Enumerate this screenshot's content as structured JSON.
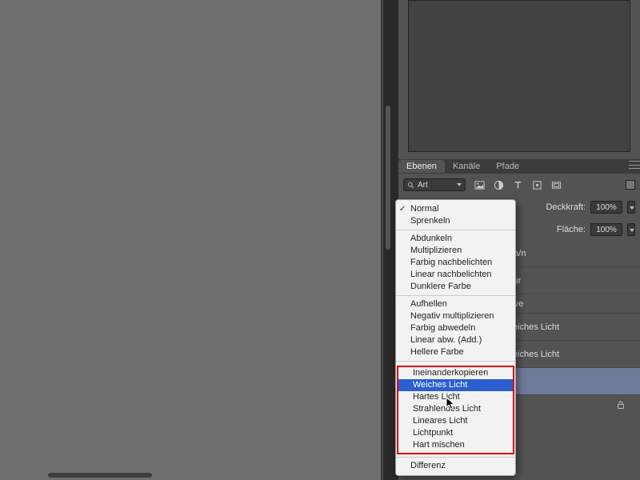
{
  "tabs": {
    "layers": "Ebenen",
    "channels": "Kanäle",
    "paths": "Pfade"
  },
  "search": {
    "label": "Art"
  },
  "opacity": {
    "label": "Deckkraft:",
    "value": "100%"
  },
  "fill": {
    "label": "Fläche:",
    "value": "100%"
  },
  "layers": {
    "l0": "e a/n",
    "l1": "ktur",
    "l2": "urve",
    "l3": "weiches Licht",
    "l4": "weiches Licht"
  },
  "blend": {
    "g1": {
      "normal": "Normal",
      "dissolve": "Sprenkeln"
    },
    "g2": {
      "darken": "Abdunkeln",
      "multiply": "Multiplizieren",
      "colorburn": "Farbig nachbelichten",
      "linearburn": "Linear nachbelichten",
      "darker": "Dunklere Farbe"
    },
    "g3": {
      "lighten": "Aufhellen",
      "screen": "Negativ multiplizieren",
      "colordodge": "Farbig abwedeln",
      "lineardodge": "Linear abw. (Add.)",
      "lighter": "Hellere Farbe"
    },
    "g4": {
      "overlay": "Ineinanderkopieren",
      "softlight": "Weiches Licht",
      "hardlight": "Hartes Licht",
      "vivid": "Strahlendes Licht",
      "linear": "Lineares Licht",
      "pin": "Lichtpunkt",
      "hardmix": "Hart mischen"
    },
    "g5": {
      "diff": "Differenz"
    }
  }
}
